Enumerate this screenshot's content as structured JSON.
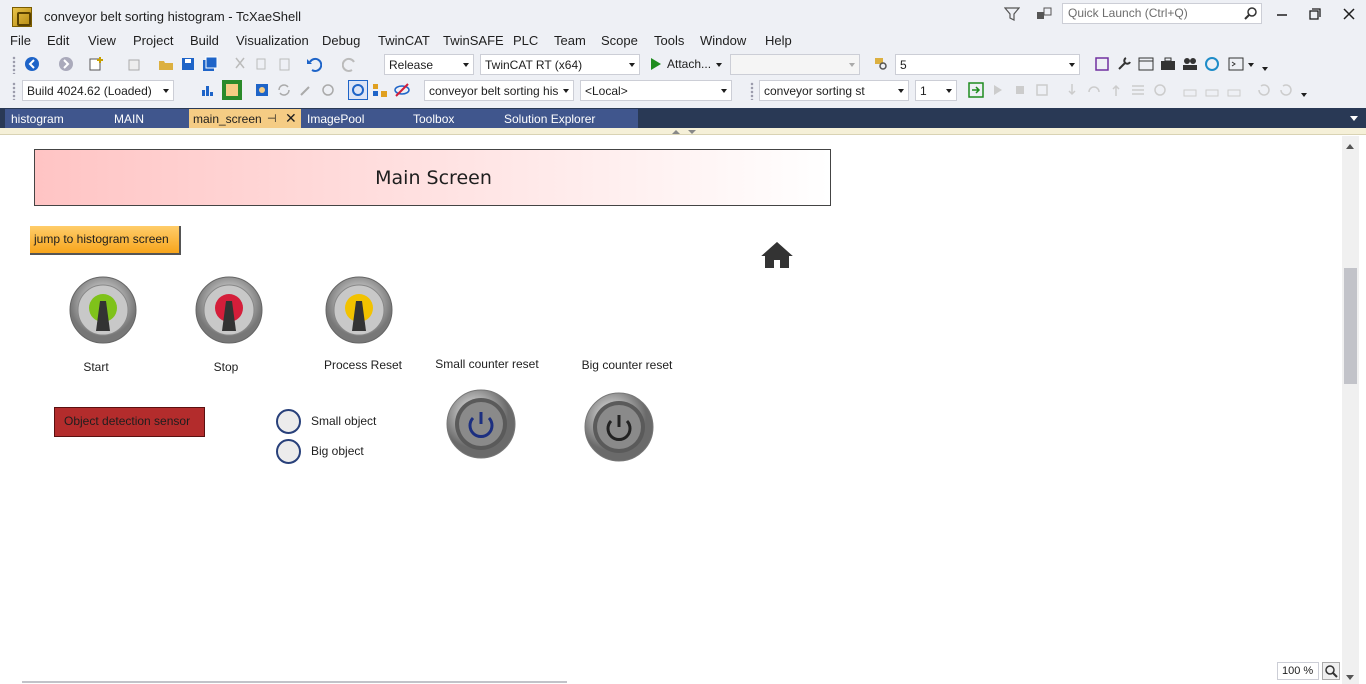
{
  "window": {
    "title": "conveyor belt sorting histogram - TcXaeShell",
    "quick_launch_placeholder": "Quick Launch (Ctrl+Q)"
  },
  "menu": [
    "File",
    "Edit",
    "View",
    "Project",
    "Build",
    "Visualization",
    "Debug",
    "TwinCAT",
    "TwinSAFE",
    "PLC",
    "Team",
    "Scope",
    "Tools",
    "Window",
    "Help"
  ],
  "toolbar1": {
    "configuration": "Release",
    "platform": "TwinCAT RT (x64)",
    "attach_label": "Attach...",
    "attach_target": "",
    "find_value": "5"
  },
  "toolbar2": {
    "build": "Build 4024.62 (Loaded)",
    "project": "conveyor belt sorting his",
    "target": "<Local>",
    "plc_project": "conveyor sorting st",
    "instance": "1"
  },
  "tabs": [
    {
      "label": "histogram"
    },
    {
      "label": "MAIN"
    },
    {
      "label": "main_screen",
      "active": true
    },
    {
      "label": "ImagePool"
    },
    {
      "label": "Toolbox"
    },
    {
      "label": "Solution Explorer"
    }
  ],
  "tab_icons": {
    "pin": "⊣",
    "close": "✕"
  },
  "screen": {
    "title": "Main Screen",
    "jump_button": "jump to histogram screen",
    "switches": [
      {
        "label": "Start",
        "color": "#7fc21a"
      },
      {
        "label": "Stop",
        "color": "#d41e3a"
      },
      {
        "label": "Process Reset",
        "color": "#f2c200"
      }
    ],
    "reset_buttons": [
      {
        "label": "Small counter reset"
      },
      {
        "label": "Big counter reset"
      }
    ],
    "sensor_label": "Object detection sensor",
    "radios": [
      {
        "label": "Small object"
      },
      {
        "label": "Big object"
      }
    ]
  },
  "zoom": "100 %",
  "colors": {
    "active_tab": "#f5cc84",
    "tab_bar": "#293955",
    "tab_strip": "#40568d",
    "sensor": "#b32c2c",
    "jump_button": "#f7a51c"
  }
}
